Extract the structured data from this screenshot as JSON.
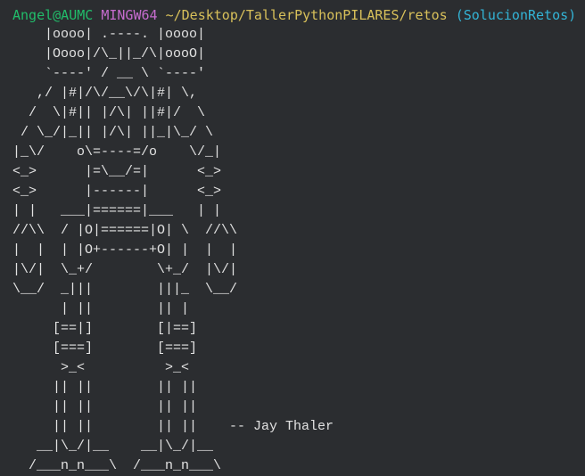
{
  "terminal": {
    "prompt": {
      "user_host": "Angel@AUMC",
      "shell": "MINGW64",
      "path": "~/Desktop/TallerPythonPILARES/retos",
      "branch": "(SolucionRetos)"
    },
    "art_lines": [
      "    |oooo| .----. |oooo|",
      "    |Oooo|/\\_||_/\\|oooO|",
      "    `----' / __ \\ `----'",
      "   ,/ |#|/\\/__\\/\\|#| \\,",
      "  /  \\|#|| |/\\| ||#|/  \\",
      " / \\_/|_|| |/\\| ||_|\\_/ \\",
      "|_\\/    o\\=----=/o    \\/_|",
      "<_>      |=\\__/=|      <_>",
      "<_>      |------|      <_>",
      "| |   ___|======|___   | |",
      "//\\\\  / |O|======|O| \\  //\\\\",
      "|  |  | |O+------+O| |  |  |",
      "|\\/|  \\_+/        \\+_/  |\\/|",
      "\\__/  _|||        |||_  \\__/",
      "      | ||        || |",
      "     [==|]        [|==]",
      "     [===]        [===]",
      "      >_<          >_<",
      "     || ||        || ||",
      "     || ||        || ||",
      "     || ||        || ||    -- Jay Thaler",
      "   __|\\_/|__    __|\\_/|__",
      "  /___n_n___\\  /___n_n___\\"
    ]
  }
}
